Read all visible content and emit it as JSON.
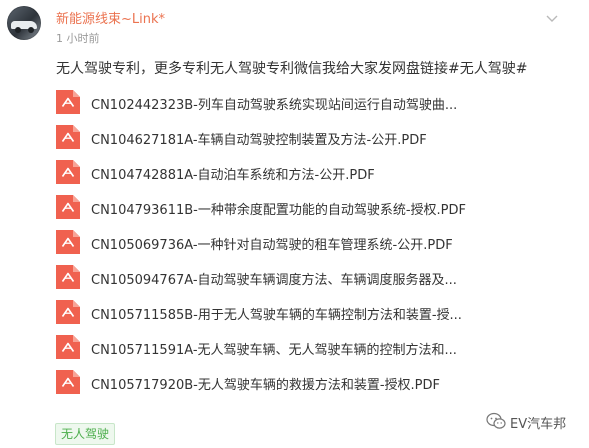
{
  "post": {
    "author": "新能源线束~Link*",
    "time": "1 小时前",
    "text": "无人驾驶专利，更多专利无人驾驶专利微信我给大家发网盘链接#无人驾驶#",
    "tag": "无人驾驶"
  },
  "files": [
    {
      "name": "CN102442323B-列车自动驾驶系统实现站间运行自动驾驶曲...",
      "icon": "pdf-file-icon"
    },
    {
      "name": "CN104627181A-车辆自动驾驶控制装置及方法-公开.PDF",
      "icon": "pdf-file-icon"
    },
    {
      "name": "CN104742881A-自动泊车系统和方法-公开.PDF",
      "icon": "pdf-file-icon"
    },
    {
      "name": "CN104793611B-一种带余度配置功能的自动驾驶系统-授权.PDF",
      "icon": "pdf-file-icon"
    },
    {
      "name": "CN105069736A-一种针对自动驾驶的租车管理系统-公开.PDF",
      "icon": "pdf-file-icon"
    },
    {
      "name": "CN105094767A-自动驾驶车辆调度方法、车辆调度服务器及...",
      "icon": "pdf-file-icon"
    },
    {
      "name": "CN105711585B-用于无人驾驶车辆的车辆控制方法和装置-授...",
      "icon": "pdf-file-icon"
    },
    {
      "name": "CN105711591A-无人驾驶车辆、无人驾驶车辆的控制方法和...",
      "icon": "pdf-file-icon"
    },
    {
      "name": "CN105717920B-无人驾驶车辆的救援方法和装置-授权.PDF",
      "icon": "pdf-file-icon"
    }
  ],
  "watermark": {
    "text": "EV汽车邦",
    "icon": "wechat-icon"
  },
  "colors": {
    "author": "#eb7350",
    "pdf_icon": "#f0614f",
    "tag_text": "#4cae4c",
    "tag_bg": "#eef8ee"
  }
}
